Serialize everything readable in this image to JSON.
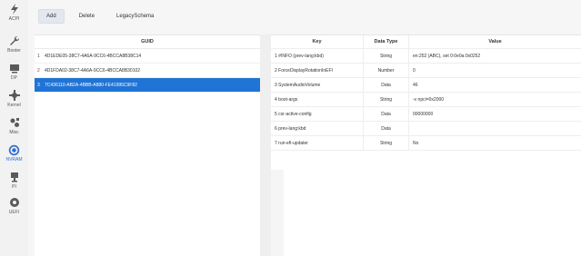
{
  "sidebar": {
    "items": [
      {
        "label": "ACPI",
        "icon": "acpi-icon"
      },
      {
        "label": "Booter",
        "icon": "wrench-icon"
      },
      {
        "label": "DP",
        "icon": "device-properties-icon"
      },
      {
        "label": "Kernel",
        "icon": "kernel-icon"
      },
      {
        "label": "Misc",
        "icon": "misc-icon"
      },
      {
        "label": "NVRAM",
        "icon": "nvram-icon",
        "active": true
      },
      {
        "label": "PI",
        "icon": "platform-info-icon"
      },
      {
        "label": "UEFI",
        "icon": "uefi-icon"
      }
    ]
  },
  "toolbar": {
    "add_label": "Add",
    "delete_label": "Delete",
    "legacy_label": "LegacySchema"
  },
  "left": {
    "header": "GUID",
    "rows": [
      {
        "index": "1",
        "guid": "4D1EDE05-38C7-4A6A-9CC6-4BCCA8B38C14"
      },
      {
        "index": "2",
        "guid": "4D1FDA02-38C7-4A6A-9CC6-4BCCA8B30102"
      },
      {
        "index": "3",
        "guid": "7C436110-AB2A-4BBB-A880-FE41995C9F82",
        "selected": true
      }
    ]
  },
  "right": {
    "headers": {
      "key": "Key",
      "type": "Data Type",
      "value": "Value"
    },
    "rows": [
      {
        "key": "1  #INFO (prev-lang:kbd)",
        "type": "String",
        "value": "en:252 (ABC), set 0:0e0a:0x0252"
      },
      {
        "key": "2  ForceDisplayRotationInEFI",
        "type": "Number",
        "value": "0"
      },
      {
        "key": "3  SystemAudioVolume",
        "type": "Data",
        "value": "46"
      },
      {
        "key": "4  boot-args",
        "type": "String",
        "value": "-v npci=0x2000"
      },
      {
        "key": "5  csr-active-config",
        "type": "Data",
        "value": "00000000"
      },
      {
        "key": "6  prev-lang:kbd",
        "type": "Data",
        "value": ""
      },
      {
        "key": "7  run-efi-updater",
        "type": "String",
        "value": "No"
      }
    ]
  },
  "colors": {
    "accent": "#1f74d6",
    "active_icon": "#2f6fd0"
  }
}
